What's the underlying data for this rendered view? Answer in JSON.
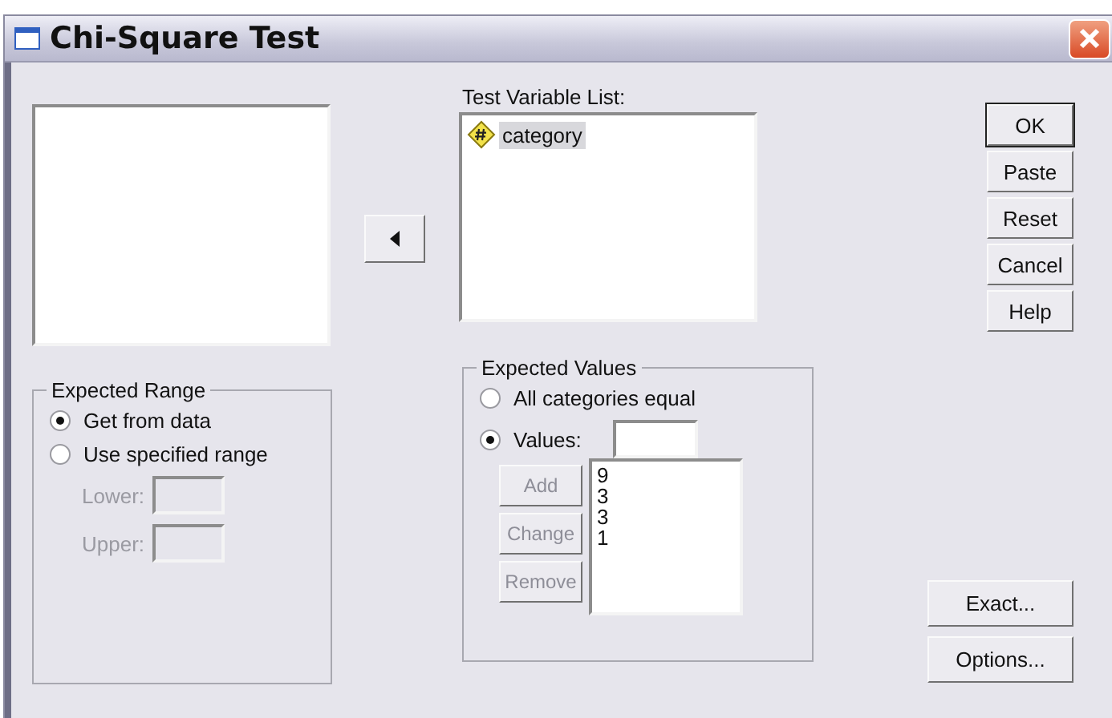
{
  "window": {
    "title": "Chi-Square Test"
  },
  "test_variable_list": {
    "label": "Test Variable List:",
    "items": [
      {
        "name": "category",
        "selected": true
      }
    ]
  },
  "buttons": [
    {
      "label": "OK",
      "default": true
    },
    {
      "label": "Paste",
      "default": false
    },
    {
      "label": "Reset",
      "default": false
    },
    {
      "label": "Cancel",
      "default": false
    },
    {
      "label": "Help",
      "default": false
    }
  ],
  "expected_range": {
    "title": "Expected Range",
    "options": [
      {
        "label": "Get from data",
        "selected": true
      },
      {
        "label": "Use specified range",
        "selected": false
      }
    ],
    "fields": [
      {
        "label": "Lower:",
        "disabled": true
      },
      {
        "label": "Upper:",
        "disabled": true
      }
    ]
  },
  "expected_values": {
    "title": "Expected Values",
    "options": [
      {
        "label": "All categories equal",
        "selected": false
      },
      {
        "label": "Values:",
        "selected": true
      }
    ],
    "buttons": [
      {
        "label": "Add",
        "disabled": true
      },
      {
        "label": "Change",
        "disabled": true
      },
      {
        "label": "Remove",
        "disabled": true
      }
    ],
    "values": [
      "9",
      "3",
      "3",
      "1"
    ]
  },
  "extra_buttons": [
    {
      "label": "Exact..."
    },
    {
      "label": "Options..."
    }
  ]
}
